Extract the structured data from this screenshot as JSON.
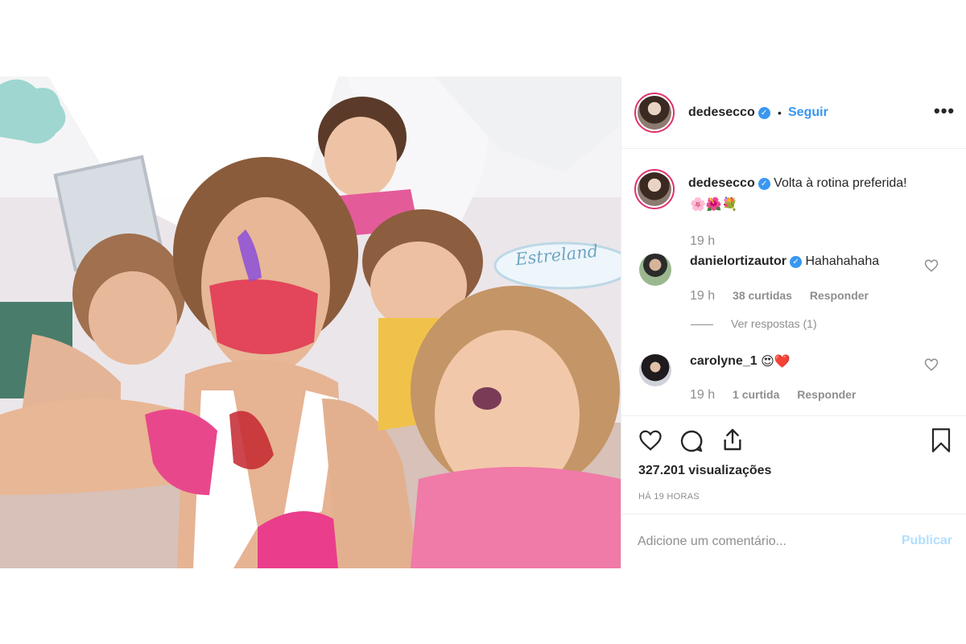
{
  "header": {
    "username": "dedesecco",
    "separator": "•",
    "follow_label": "Seguir",
    "more_label": "•••"
  },
  "photo": {
    "sign_text": "Estreland"
  },
  "caption": {
    "username": "dedesecco",
    "text": "Volta à rotina preferida!",
    "emojis": "🌸🌺💐",
    "time": "19 h"
  },
  "comments": [
    {
      "username": "danielortizautor",
      "text": "Hahahahaha",
      "time": "19 h",
      "likes": "38 curtidas",
      "reply": "Responder",
      "view_replies": "Ver respostas (1)"
    },
    {
      "username": "carolyne_1",
      "text": "😍❤️",
      "time": "19 h",
      "likes": "1 curtida",
      "reply": "Responder"
    }
  ],
  "stats": {
    "views": "327.201 visualizações",
    "ago": "HÁ 19 HORAS"
  },
  "add_comment": {
    "placeholder": "Adicione um comentário...",
    "publish_label": "Publicar"
  },
  "colors": {
    "link_blue": "#3897f0",
    "publish_disabled": "#b2dffc",
    "muted": "#8e8e8e",
    "verified": "#3897f0"
  }
}
